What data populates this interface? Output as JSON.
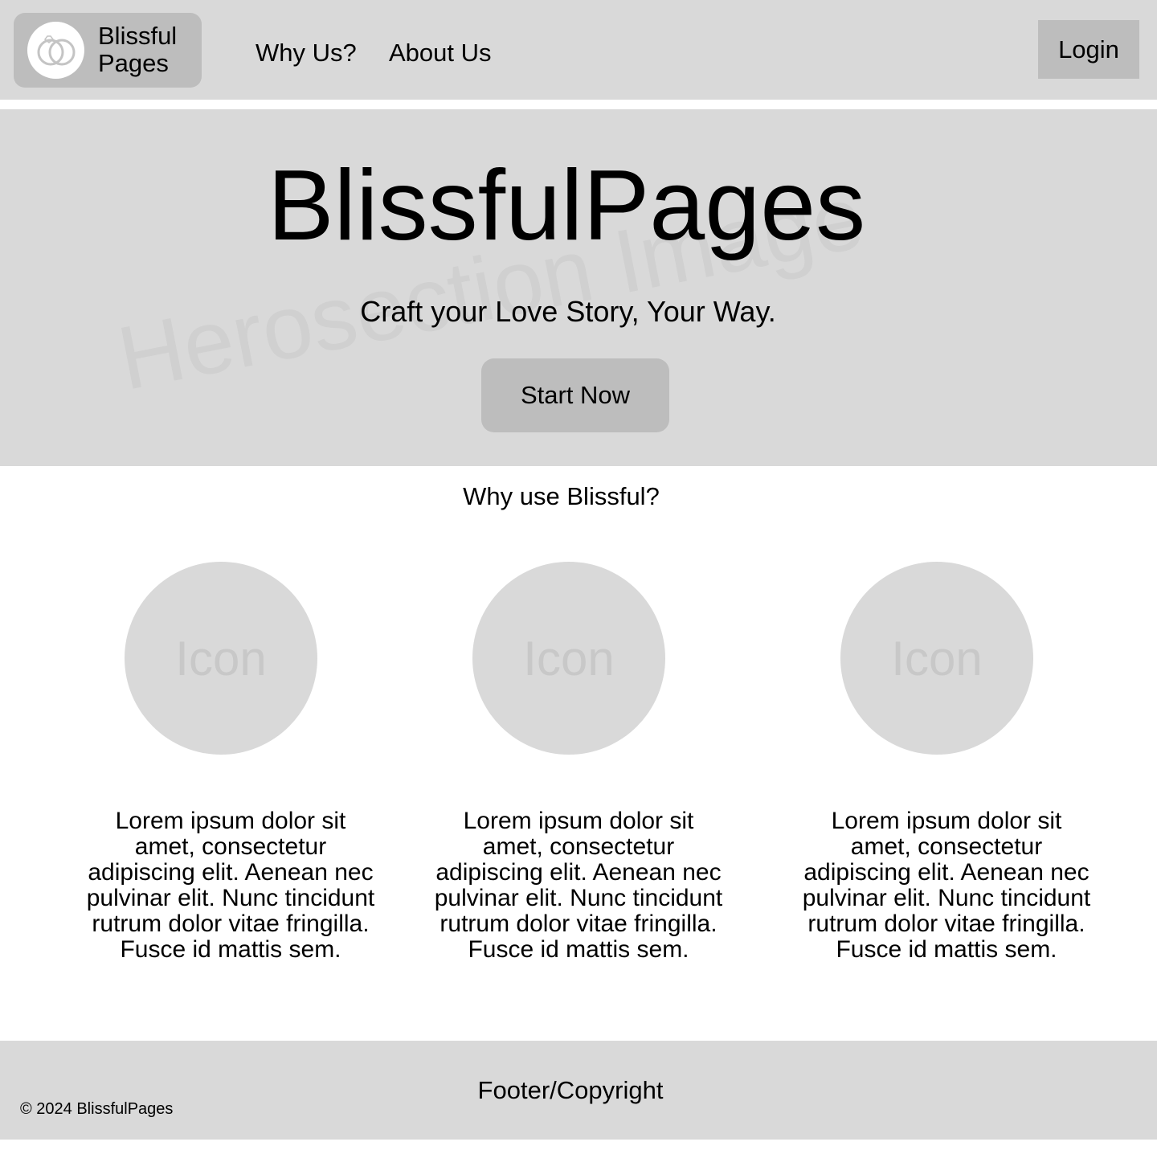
{
  "header": {
    "logo_line1": "Blissful",
    "logo_line2": "Pages",
    "nav": {
      "why": "Why Us?",
      "about": "About Us"
    },
    "login_label": "Login"
  },
  "hero": {
    "title": "BlissfulPages",
    "tagline": "Craft your Love Story, Your Way.",
    "cta_label": "Start Now",
    "placeholder_watermark": "Herosection Image"
  },
  "why_section": {
    "heading": "Why use Blissful?",
    "features": [
      {
        "icon_label": "Icon",
        "text": "Lorem ipsum dolor sit amet, consectetur adipiscing elit. Aenean nec pulvinar elit. Nunc tincidunt rutrum dolor vitae fringilla. Fusce id mattis sem."
      },
      {
        "icon_label": "Icon",
        "text": "Lorem ipsum dolor sit amet, consectetur adipiscing elit. Aenean nec pulvinar elit. Nunc tincidunt rutrum dolor vitae fringilla. Fusce id mattis sem."
      },
      {
        "icon_label": "Icon",
        "text": "Lorem ipsum dolor sit amet, consectetur adipiscing elit. Aenean nec pulvinar elit. Nunc tincidunt rutrum dolor vitae fringilla. Fusce id mattis sem."
      }
    ]
  },
  "footer": {
    "label": "Footer/Copyright",
    "copyright": "© 2024 BlissfulPages"
  },
  "colors": {
    "panel_gray": "#d9d9d9",
    "button_gray": "#bdbdbd",
    "placeholder_text": "#c8c8c8"
  }
}
